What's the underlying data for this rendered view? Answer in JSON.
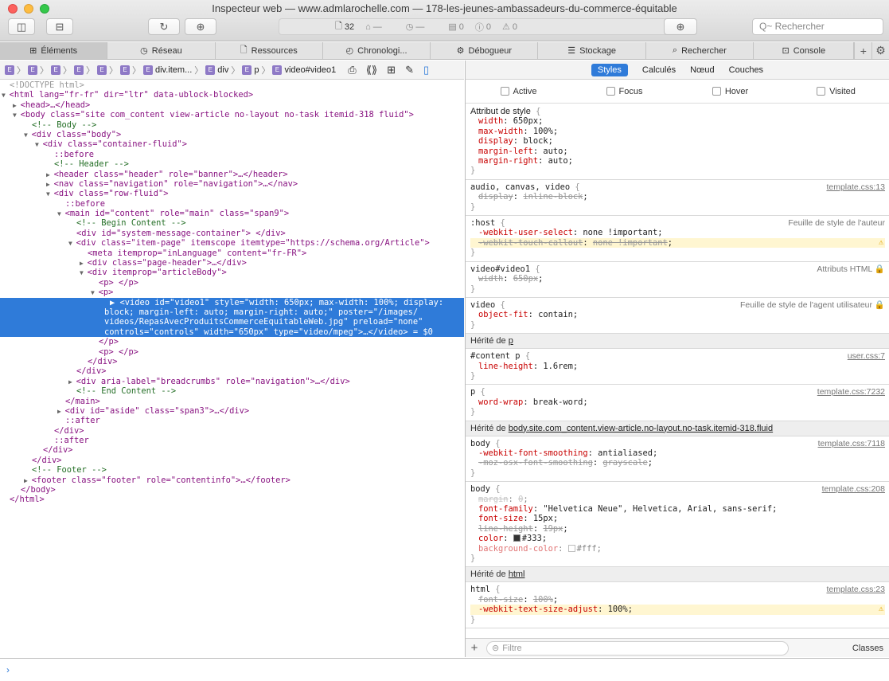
{
  "window": {
    "title": "Inspecteur web — www.admlarochelle.com — 178-les-jeunes-ambassadeurs-du-commerce-équitable",
    "traffic_lights": [
      "#fc615d",
      "#fdbc40",
      "#34c84a"
    ]
  },
  "toolbar": {
    "resource_count": "32",
    "errors": "0",
    "warnings": "0",
    "logs": "0",
    "dash1": "—",
    "dash2": "—",
    "search_placeholder": "Q~ Rechercher"
  },
  "tabs": [
    {
      "label": "Éléments",
      "icon": "elements-icon",
      "active": true
    },
    {
      "label": "Réseau",
      "icon": "network-icon"
    },
    {
      "label": "Ressources",
      "icon": "resources-icon"
    },
    {
      "label": "Chronologi...",
      "icon": "timeline-icon"
    },
    {
      "label": "Débogueur",
      "icon": "debugger-icon"
    },
    {
      "label": "Stockage",
      "icon": "storage-icon"
    },
    {
      "label": "Rechercher",
      "icon": "search-icon"
    },
    {
      "label": "Console",
      "icon": "console-icon"
    }
  ],
  "breadcrumb": {
    "items": [
      "div.item...",
      "div",
      "p",
      "video#video1"
    ]
  },
  "style_tabs": [
    "Styles",
    "Calculés",
    "Nœud",
    "Couches"
  ],
  "pseudo_classes": [
    "Active",
    "Focus",
    "Hover",
    "Visited"
  ],
  "dom_lines": [
    {
      "t": "<!DOCTYPE html>",
      "cls": "dt",
      "indent": 0,
      "arrow": ""
    },
    {
      "t": "<html lang=\"fr-fr\" dir=\"ltr\" data-ublock-blocked>",
      "cls": "tag",
      "indent": 0,
      "arrow": "▼"
    },
    {
      "t": "<head>…</head>",
      "cls": "tag",
      "indent": 1,
      "arrow": "▶"
    },
    {
      "t": "<body class=\"site com_content view-article no-layout no-task itemid-318 fluid\">",
      "cls": "tag",
      "indent": 1,
      "arrow": "▼"
    },
    {
      "t": "<!-- Body -->",
      "cls": "cm",
      "indent": 2,
      "arrow": ""
    },
    {
      "t": "<div class=\"body\">",
      "cls": "tag",
      "indent": 2,
      "arrow": "▼"
    },
    {
      "t": "<div class=\"container-fluid\">",
      "cls": "tag",
      "indent": 3,
      "arrow": "▼"
    },
    {
      "t": "::before",
      "cls": "tag",
      "indent": 4,
      "arrow": ""
    },
    {
      "t": "<!-- Header -->",
      "cls": "cm",
      "indent": 4,
      "arrow": ""
    },
    {
      "t": "<header class=\"header\" role=\"banner\">…</header>",
      "cls": "tag",
      "indent": 4,
      "arrow": "▶"
    },
    {
      "t": "<nav class=\"navigation\" role=\"navigation\">…</nav>",
      "cls": "tag",
      "indent": 4,
      "arrow": "▶"
    },
    {
      "t": "<div class=\"row-fluid\">",
      "cls": "tag",
      "indent": 4,
      "arrow": "▼"
    },
    {
      "t": "::before",
      "cls": "tag",
      "indent": 5,
      "arrow": ""
    },
    {
      "t": "<main id=\"content\" role=\"main\" class=\"span9\">",
      "cls": "tag",
      "indent": 5,
      "arrow": "▼"
    },
    {
      "t": "<!-- Begin Content -->",
      "cls": "cm",
      "indent": 6,
      "arrow": ""
    },
    {
      "t": "<div id=\"system-message-container\"> </div>",
      "cls": "tag",
      "indent": 6,
      "arrow": ""
    },
    {
      "t": "<div class=\"item-page\" itemscope itemtype=\"https://schema.org/Article\">",
      "cls": "tag",
      "indent": 6,
      "arrow": "▼"
    },
    {
      "t": "<meta itemprop=\"inLanguage\" content=\"fr-FR\">",
      "cls": "tag",
      "indent": 7,
      "arrow": ""
    },
    {
      "t": "<div class=\"page-header\">…</div>",
      "cls": "tag",
      "indent": 7,
      "arrow": "▶"
    },
    {
      "t": "<div itemprop=\"articleBody\">",
      "cls": "tag",
      "indent": 7,
      "arrow": "▼"
    },
    {
      "t": "<p> </p>",
      "cls": "tag",
      "indent": 8,
      "arrow": ""
    },
    {
      "t": "<p>",
      "cls": "tag",
      "indent": 8,
      "arrow": "▼"
    },
    {
      "t": "▶ <video id=\"video1\" style=\"width: 650px; max-width: 100%; display:",
      "cls": "tag",
      "indent": 9,
      "arrow": "",
      "sel": true
    },
    {
      "t": "block; margin-left: auto; margin-right: auto;\" poster=\"/images/",
      "cls": "tag",
      "indent": 8.5,
      "arrow": "",
      "sel": true
    },
    {
      "t": "videos/RepasAvecProduitsCommerceEquitableWeb.jpg\" preload=\"none\"",
      "cls": "tag",
      "indent": 8.5,
      "arrow": "",
      "sel": true
    },
    {
      "t": "controls=\"controls\" width=\"650px\" type=\"video/mpeg\">…</video> = $0",
      "cls": "tag",
      "indent": 8.5,
      "arrow": "",
      "sel": true
    },
    {
      "t": "</p>",
      "cls": "tag",
      "indent": 8,
      "arrow": ""
    },
    {
      "t": "<p> </p>",
      "cls": "tag",
      "indent": 8,
      "arrow": ""
    },
    {
      "t": "</div>",
      "cls": "tag",
      "indent": 7,
      "arrow": ""
    },
    {
      "t": "</div>",
      "cls": "tag",
      "indent": 6,
      "arrow": ""
    },
    {
      "t": "<div aria-label=\"breadcrumbs\" role=\"navigation\">…</div>",
      "cls": "tag",
      "indent": 6,
      "arrow": "▶"
    },
    {
      "t": "<!-- End Content -->",
      "cls": "cm",
      "indent": 6,
      "arrow": ""
    },
    {
      "t": "</main>",
      "cls": "tag",
      "indent": 5,
      "arrow": ""
    },
    {
      "t": "<div id=\"aside\" class=\"span3\">…</div>",
      "cls": "tag",
      "indent": 5,
      "arrow": "▶"
    },
    {
      "t": "::after",
      "cls": "tag",
      "indent": 5,
      "arrow": ""
    },
    {
      "t": "</div>",
      "cls": "tag",
      "indent": 4,
      "arrow": ""
    },
    {
      "t": "::after",
      "cls": "tag",
      "indent": 4,
      "arrow": ""
    },
    {
      "t": "</div>",
      "cls": "tag",
      "indent": 3,
      "arrow": ""
    },
    {
      "t": "</div>",
      "cls": "tag",
      "indent": 2,
      "arrow": ""
    },
    {
      "t": "<!-- Footer -->",
      "cls": "cm",
      "indent": 2,
      "arrow": ""
    },
    {
      "t": "<footer class=\"footer\" role=\"contentinfo\">…</footer>",
      "cls": "tag",
      "indent": 2,
      "arrow": "▶"
    },
    {
      "t": "</body>",
      "cls": "tag",
      "indent": 1,
      "arrow": ""
    },
    {
      "t": "</html>",
      "cls": "tag",
      "indent": 0,
      "arrow": ""
    }
  ],
  "rules": [
    {
      "type": "rule",
      "selector": "Attribut de style",
      "sans": true,
      "source": "",
      "decls": [
        {
          "p": "width",
          "v": "650px"
        },
        {
          "p": "max-width",
          "v": "100%"
        },
        {
          "p": "display",
          "v": "block"
        },
        {
          "p": "margin-left",
          "v": "auto"
        },
        {
          "p": "margin-right",
          "v": "auto"
        }
      ]
    },
    {
      "type": "rule",
      "selector": "audio, canvas, video",
      "source": "template.css:13",
      "link": true,
      "decls": [
        {
          "p": "display",
          "v": "inline-block",
          "ov": true
        }
      ]
    },
    {
      "type": "rule",
      "selector": ":host",
      "source": "Feuille de style de l'auteur",
      "decls": [
        {
          "p": "-webkit-user-select",
          "v": "none !important"
        },
        {
          "p": "-webkit-touch-callout",
          "v": "none !important",
          "ov": true,
          "warn": true
        }
      ]
    },
    {
      "type": "rule",
      "selector": "video#video1",
      "source": "Attributs HTML 🔒",
      "decls": [
        {
          "p": "width",
          "v": "650px",
          "ov": true
        }
      ]
    },
    {
      "type": "rule",
      "selector": "video",
      "source": "Feuille de style de l'agent utilisateur 🔒",
      "decls": [
        {
          "p": "object-fit",
          "v": "contain"
        }
      ]
    },
    {
      "type": "inh",
      "label": "Hérité de ",
      "target": "p"
    },
    {
      "type": "rule",
      "selector": "#content p",
      "source": "user.css:7",
      "link": true,
      "decls": [
        {
          "p": "line-height",
          "v": "1.6rem"
        }
      ]
    },
    {
      "type": "rule",
      "selector": "p",
      "source": "template.css:7232",
      "link": true,
      "decls": [
        {
          "p": "word-wrap",
          "v": "break-word"
        }
      ]
    },
    {
      "type": "inh",
      "label": "Hérité de ",
      "target": "body.site.com_content.view-article.no-layout.no-task.itemid-318.fluid"
    },
    {
      "type": "rule",
      "selector": "body",
      "source": "template.css:7118",
      "link": true,
      "decls": [
        {
          "p": "-webkit-font-smoothing",
          "v": "antialiased"
        },
        {
          "p": "-moz-osx-font-smoothing",
          "v": "grayscale",
          "ov": true
        }
      ]
    },
    {
      "type": "rule",
      "selector": "body",
      "source": "template.css:208",
      "link": true,
      "decls": [
        {
          "p": "margin",
          "v": "0",
          "ov": true,
          "soft": true
        },
        {
          "p": "font-family",
          "v": "\"Helvetica Neue\", Helvetica, Arial, sans-serif"
        },
        {
          "p": "font-size",
          "v": "15px"
        },
        {
          "p": "line-height",
          "v": "19px",
          "ov": true
        },
        {
          "p": "color",
          "v": "#333",
          "swatch": "#333333"
        },
        {
          "p": "background-color",
          "v": "#fff",
          "soft": true,
          "swatch": "#ffffff"
        }
      ]
    },
    {
      "type": "inh",
      "label": "Hérité de ",
      "target": "html"
    },
    {
      "type": "rule",
      "selector": "html",
      "source": "template.css:23",
      "link": true,
      "decls": [
        {
          "p": "font-size",
          "v": "100%",
          "ov": true
        },
        {
          "p": "-webkit-text-size-adjust",
          "v": "100%",
          "warn": true
        }
      ]
    }
  ],
  "filter": {
    "placeholder": "Filtre",
    "classes_label": "Classes"
  },
  "console": {
    "prompt": "›"
  }
}
